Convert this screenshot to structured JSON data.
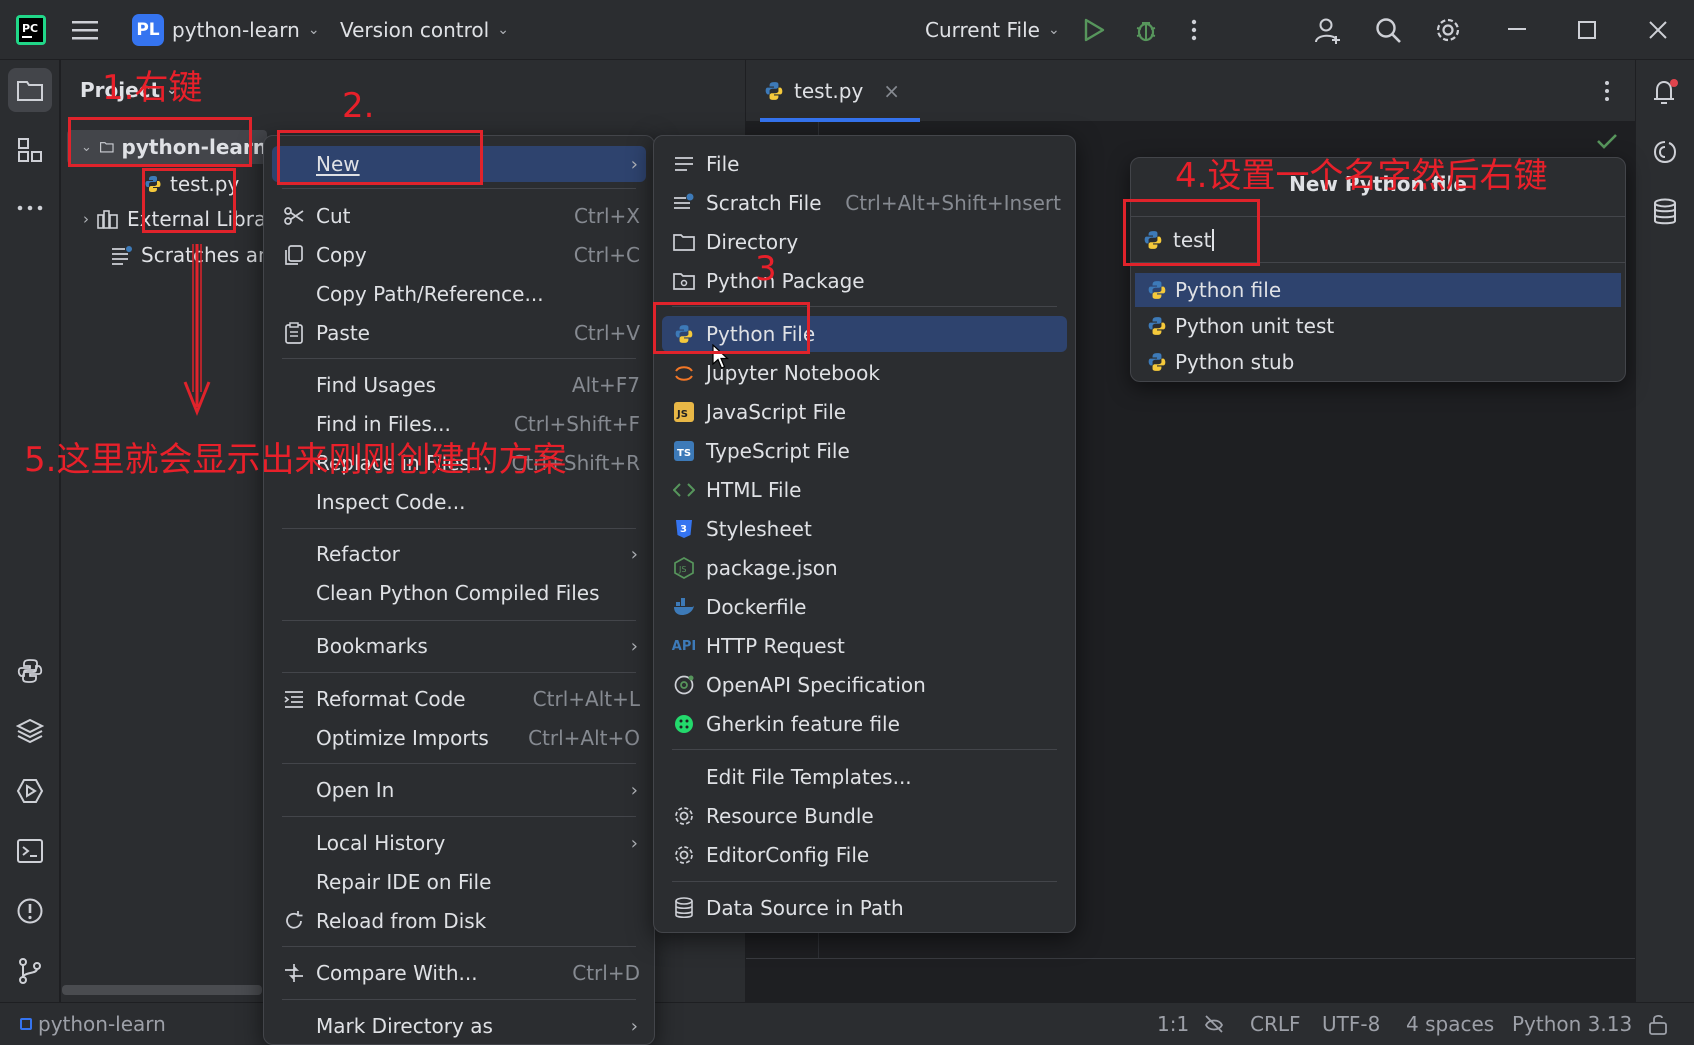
{
  "titlebar": {
    "project_badge": "PL",
    "project_name": "python-learn",
    "vcs_label": "Version control",
    "run_config": "Current File"
  },
  "project_panel": {
    "title": "Project",
    "root": "python-learn",
    "file": "test.py",
    "external": "External Libraries",
    "scratches": "Scratches and Consoles"
  },
  "editor": {
    "tab_name": "test.py"
  },
  "context_menu": {
    "items": [
      {
        "label": "New",
        "shortcut": ""
      },
      {
        "label": "Cut",
        "shortcut": "Ctrl+X"
      },
      {
        "label": "Copy",
        "shortcut": "Ctrl+C"
      },
      {
        "label": "Copy Path/Reference...",
        "shortcut": ""
      },
      {
        "label": "Paste",
        "shortcut": "Ctrl+V"
      },
      {
        "label": "Find Usages",
        "shortcut": "Alt+F7"
      },
      {
        "label": "Find in Files...",
        "shortcut": "Ctrl+Shift+F"
      },
      {
        "label": "Replace in Files...",
        "shortcut": "Ctrl+Shift+R"
      },
      {
        "label": "Inspect Code...",
        "shortcut": ""
      },
      {
        "label": "Refactor",
        "shortcut": ""
      },
      {
        "label": "Clean Python Compiled Files",
        "shortcut": ""
      },
      {
        "label": "Bookmarks",
        "shortcut": ""
      },
      {
        "label": "Reformat Code",
        "shortcut": "Ctrl+Alt+L"
      },
      {
        "label": "Optimize Imports",
        "shortcut": "Ctrl+Alt+O"
      },
      {
        "label": "Open In",
        "shortcut": ""
      },
      {
        "label": "Local History",
        "shortcut": ""
      },
      {
        "label": "Repair IDE on File",
        "shortcut": ""
      },
      {
        "label": "Reload from Disk",
        "shortcut": ""
      },
      {
        "label": "Compare With...",
        "shortcut": "Ctrl+D"
      },
      {
        "label": "Mark Directory as",
        "shortcut": ""
      }
    ]
  },
  "new_menu": {
    "items": [
      {
        "label": "File",
        "shortcut": ""
      },
      {
        "label": "Scratch File",
        "shortcut": "Ctrl+Alt+Shift+Insert"
      },
      {
        "label": "Directory",
        "shortcut": ""
      },
      {
        "label": "Python Package",
        "shortcut": ""
      },
      {
        "label": "Python File",
        "shortcut": ""
      },
      {
        "label": "Jupyter Notebook",
        "shortcut": ""
      },
      {
        "label": "JavaScript File",
        "shortcut": ""
      },
      {
        "label": "TypeScript File",
        "shortcut": ""
      },
      {
        "label": "HTML File",
        "shortcut": ""
      },
      {
        "label": "Stylesheet",
        "shortcut": ""
      },
      {
        "label": "package.json",
        "shortcut": ""
      },
      {
        "label": "Dockerfile",
        "shortcut": ""
      },
      {
        "label": "HTTP Request",
        "shortcut": ""
      },
      {
        "label": "OpenAPI Specification",
        "shortcut": ""
      },
      {
        "label": "Gherkin feature file",
        "shortcut": ""
      },
      {
        "label": "Edit File Templates...",
        "shortcut": ""
      },
      {
        "label": "Resource Bundle",
        "shortcut": ""
      },
      {
        "label": "EditorConfig File",
        "shortcut": ""
      },
      {
        "label": "Data Source in Path",
        "shortcut": ""
      }
    ]
  },
  "new_python_popup": {
    "title": "New Python file",
    "input_value": "test",
    "options": [
      "Python file",
      "Python unit test",
      "Python stub"
    ]
  },
  "statusbar": {
    "project": "python-learn",
    "position": "1:1",
    "line_sep": "CRLF",
    "encoding": "UTF-8",
    "indent": "4 spaces",
    "interpreter": "Python 3.13"
  },
  "annotations": {
    "step1": "1.右键",
    "step2": "2.",
    "step3": "3",
    "step4": "4.设置一个名字然后右键",
    "step5": "5.这里就会显示出来刚刚创建的方案"
  },
  "colors": {
    "accent": "#3574f0",
    "selection": "#2e436e",
    "annotation": "#e0232b",
    "run": "#57965c"
  }
}
